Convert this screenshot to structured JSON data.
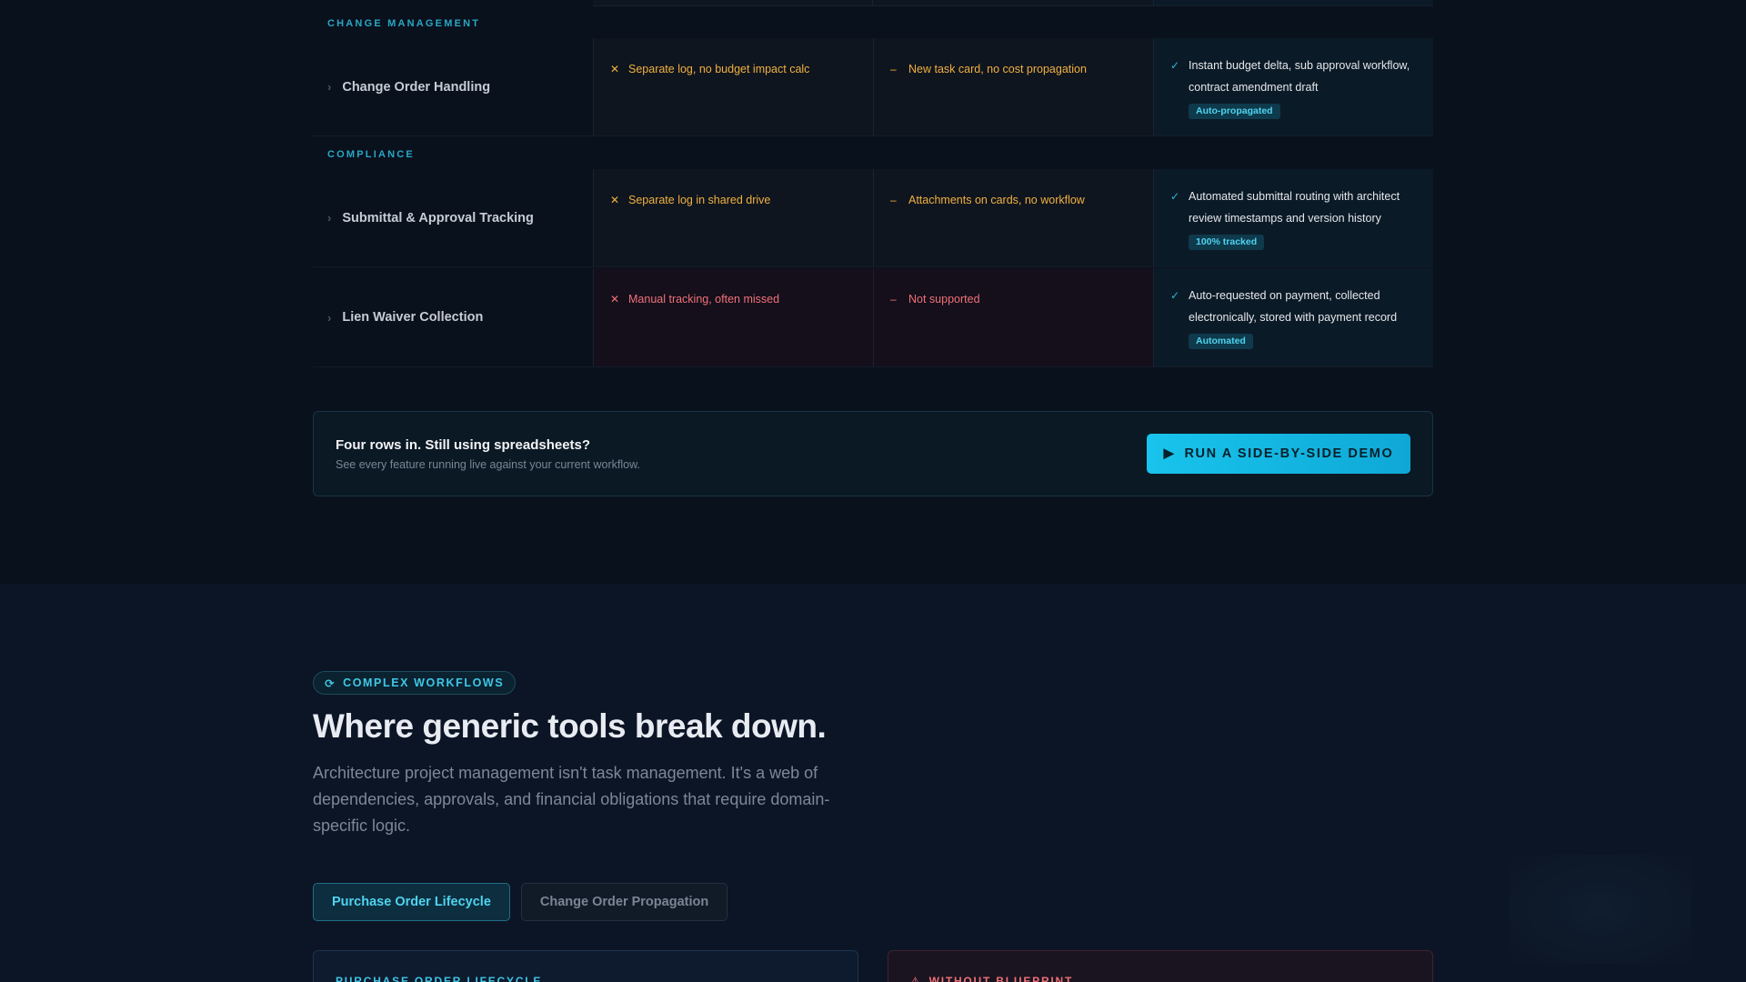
{
  "matrix": {
    "groups": [
      {
        "label": "CHANGE MANAGEMENT",
        "rows": [
          {
            "feature": "Change Order Handling",
            "col1": "Separate log, no budget impact calc",
            "col2": "New task card, no cost propagation",
            "col3": "Instant budget delta, sub approval workflow, contract amendment draft",
            "badge": "Auto-propagated"
          }
        ]
      },
      {
        "label": "COMPLIANCE",
        "rows": [
          {
            "feature": "Submittal & Approval Tracking",
            "col1": "Separate log in shared drive",
            "col2": "Attachments on cards, no workflow",
            "col3": "Automated submittal routing with architect review timestamps and version history",
            "badge": "100% tracked"
          },
          {
            "feature": "Lien Waiver Collection",
            "col1": "Manual tracking, often missed",
            "col2": "Not supported",
            "col3": "Auto-requested on payment, collected electronically, stored with payment record",
            "badge": "Automated"
          }
        ]
      }
    ]
  },
  "cta": {
    "title": "Four rows in. Still using spreadsheets?",
    "subtitle": "See every feature running live against your current workflow.",
    "button": "RUN A SIDE-BY-SIDE DEMO"
  },
  "workflows": {
    "eyebrow": "COMPLEX WORKFLOWS",
    "heading": "Where generic tools break down.",
    "lead": "Architecture project management isn't task management. It's a web of dependencies, approvals, and financial obligations that require domain-specific logic.",
    "tabs": [
      "Purchase Order Lifecycle",
      "Change Order Propagation"
    ],
    "panel_left_title": "PURCHASE ORDER LIFECYCLE",
    "panel_right_title": "WITHOUT BLUEPRINT"
  },
  "colors": {
    "accent": "#22b8d6",
    "amber": "#f0b041",
    "red": "#f07178",
    "background": "#0b1220"
  },
  "icons": {
    "x": "x-icon",
    "dash": "dash-icon",
    "check": "check-icon",
    "chevron": "chevron-right-icon",
    "play": "play-icon",
    "refresh": "refresh-icon",
    "warning": "warning-icon"
  }
}
